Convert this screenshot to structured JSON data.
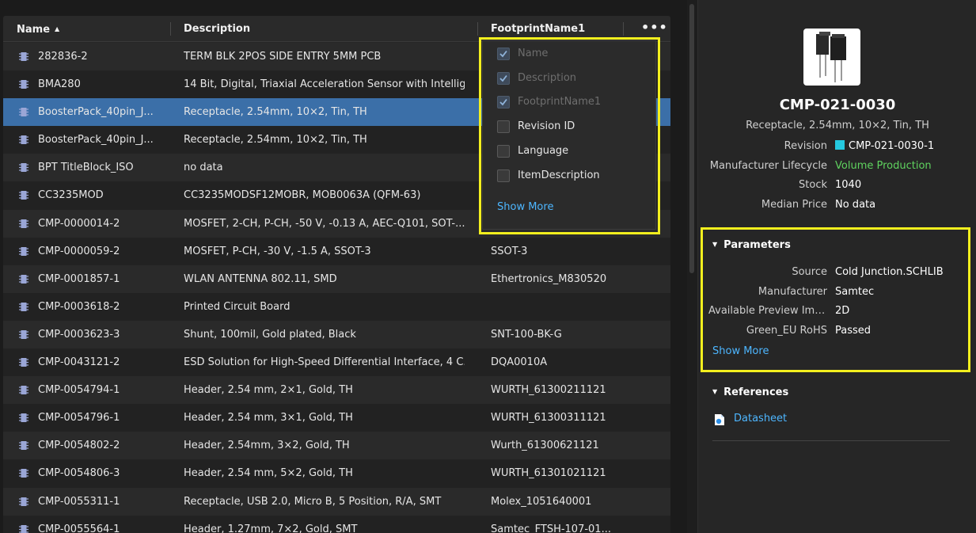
{
  "table": {
    "columns": {
      "name": "Name",
      "description": "Description",
      "footprint": "FootprintName1"
    },
    "more_label": "•••",
    "rows": [
      {
        "name": "282836-2",
        "description": "TERM BLK 2POS SIDE ENTRY 5MM PCB",
        "footprint": ""
      },
      {
        "name": "BMA280",
        "description": "14 Bit, Digital, Triaxial Acceleration Sensor with Intellig...",
        "footprint": ""
      },
      {
        "name": "BoosterPack_40pin_J...",
        "description": "Receptacle, 2.54mm, 10×2, Tin, TH",
        "footprint": ""
      },
      {
        "name": "BoosterPack_40pin_J...",
        "description": "Receptacle, 2.54mm, 10×2, Tin, TH",
        "footprint": ""
      },
      {
        "name": "BPT TitleBlock_ISO",
        "description": "no data",
        "footprint": ""
      },
      {
        "name": "CC3235MOD",
        "description": "CC3235MODSF12MOBR, MOB0063A (QFM-63)",
        "footprint": ""
      },
      {
        "name": "CMP-0000014-2",
        "description": "MOSFET, 2-CH, P-CH, -50 V, -0.13 A, AEC-Q101, SOT-...",
        "footprint": ""
      },
      {
        "name": "CMP-0000059-2",
        "description": "MOSFET, P-CH, -30 V, -1.5 A, SSOT-3",
        "footprint": "SSOT-3"
      },
      {
        "name": "CMP-0001857-1",
        "description": "WLAN ANTENNA 802.11, SMD",
        "footprint": "Ethertronics_M830520"
      },
      {
        "name": "CMP-0003618-2",
        "description": "Printed Circuit Board",
        "footprint": ""
      },
      {
        "name": "CMP-0003623-3",
        "description": "Shunt, 100mil, Gold plated, Black",
        "footprint": "SNT-100-BK-G"
      },
      {
        "name": "CMP-0043121-2",
        "description": "ESD Solution for High-Speed Differential Interface, 4 C...",
        "footprint": "DQA0010A"
      },
      {
        "name": "CMP-0054794-1",
        "description": "Header, 2.54 mm, 2×1, Gold, TH",
        "footprint": "WURTH_61300211121"
      },
      {
        "name": "CMP-0054796-1",
        "description": "Header, 2.54 mm, 3×1, Gold, TH",
        "footprint": "WURTH_61300311121"
      },
      {
        "name": "CMP-0054802-2",
        "description": "Header, 2.54mm, 3×2, Gold, TH",
        "footprint": "Wurth_61300621121"
      },
      {
        "name": "CMP-0054806-3",
        "description": "Header, 2.54 mm, 5×2, Gold, TH",
        "footprint": "WURTH_61301021121"
      },
      {
        "name": "CMP-0055311-1",
        "description": "Receptacle, USB 2.0, Micro B, 5 Position, R/A, SMT",
        "footprint": "Molex_1051640001"
      },
      {
        "name": "CMP-0055564-1",
        "description": "Header, 1.27mm, 7×2, Gold, SMT",
        "footprint": "Samtec_FTSH-107-01..."
      }
    ]
  },
  "column_menu": {
    "items": [
      {
        "label": "Name",
        "checked": true,
        "disabled": true
      },
      {
        "label": "Description",
        "checked": true,
        "disabled": true
      },
      {
        "label": "FootprintName1",
        "checked": true,
        "disabled": true
      },
      {
        "label": "Revision ID",
        "checked": false,
        "disabled": false
      },
      {
        "label": "Language",
        "checked": false,
        "disabled": false
      },
      {
        "label": "ItemDescription",
        "checked": false,
        "disabled": false
      }
    ],
    "show_more": "Show More"
  },
  "details": {
    "title": "CMP-021-0030",
    "subtitle": "Receptacle, 2.54mm, 10×2, Tin, TH",
    "props": {
      "revision_label": "Revision",
      "revision_value": "CMP-021-0030-1",
      "lifecycle_label": "Manufacturer Lifecycle",
      "lifecycle_value": "Volume Production",
      "stock_label": "Stock",
      "stock_value": "1040",
      "price_label": "Median Price",
      "price_value": "No data"
    },
    "parameters": {
      "header": "Parameters",
      "items": [
        {
          "label": "Source",
          "value": "Cold Junction.SCHLIB"
        },
        {
          "label": "Manufacturer",
          "value": "Samtec"
        },
        {
          "label": "Available Preview Ima...",
          "value": "2D"
        },
        {
          "label": "Green_EU RoHS",
          "value": "Passed"
        }
      ],
      "show_more": "Show More"
    },
    "references": {
      "header": "References",
      "datasheet": "Datasheet"
    }
  },
  "colors": {
    "selection": "#3b6fa8",
    "link": "#4db6ff",
    "lifecycle_green": "#5fd35f",
    "revision_swatch": "#25c9e0",
    "highlight": "#f3ef1e"
  }
}
